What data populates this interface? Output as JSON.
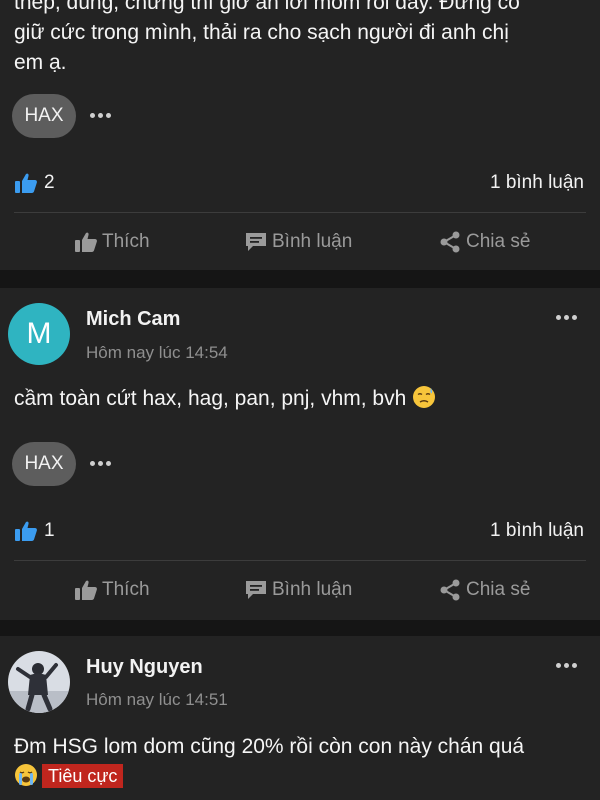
{
  "posts": [
    {
      "text_lines": [
        "thép, dùng, chứng thì giờ ăn lời mỏm rồi đấy. Đừng có",
        "giữ cức trong mình, thải ra cho sạch người đi anh chị",
        "em ạ."
      ],
      "tag": "HAX",
      "likes": "2",
      "comments": "1 bình luận",
      "actions": {
        "like": "Thích",
        "comment": "Bình luận",
        "share": "Chia sẻ"
      }
    },
    {
      "author": "Mich Cam",
      "avatar_letter": "M",
      "avatar_color": "#2fb4c1",
      "time": "Hôm nay lúc 14:54",
      "text": "cầm toàn cứt hax, hag, pan, pnj, vhm, bvh",
      "emoji": "downcast-face-with-sweat",
      "tag": "HAX",
      "likes": "1",
      "comments": "1 bình luận",
      "actions": {
        "like": "Thích",
        "comment": "Bình luận",
        "share": "Chia sẻ"
      }
    },
    {
      "author": "Huy Nguyen",
      "time": "Hôm nay lúc 14:51",
      "text": "Đm HSG lom dom cũng 20% rồi còn con này chán quá",
      "emoji": "loudly-crying-face",
      "sentiment_badge": "Tiêu cực",
      "sentiment_color": "#c0261e"
    }
  ]
}
